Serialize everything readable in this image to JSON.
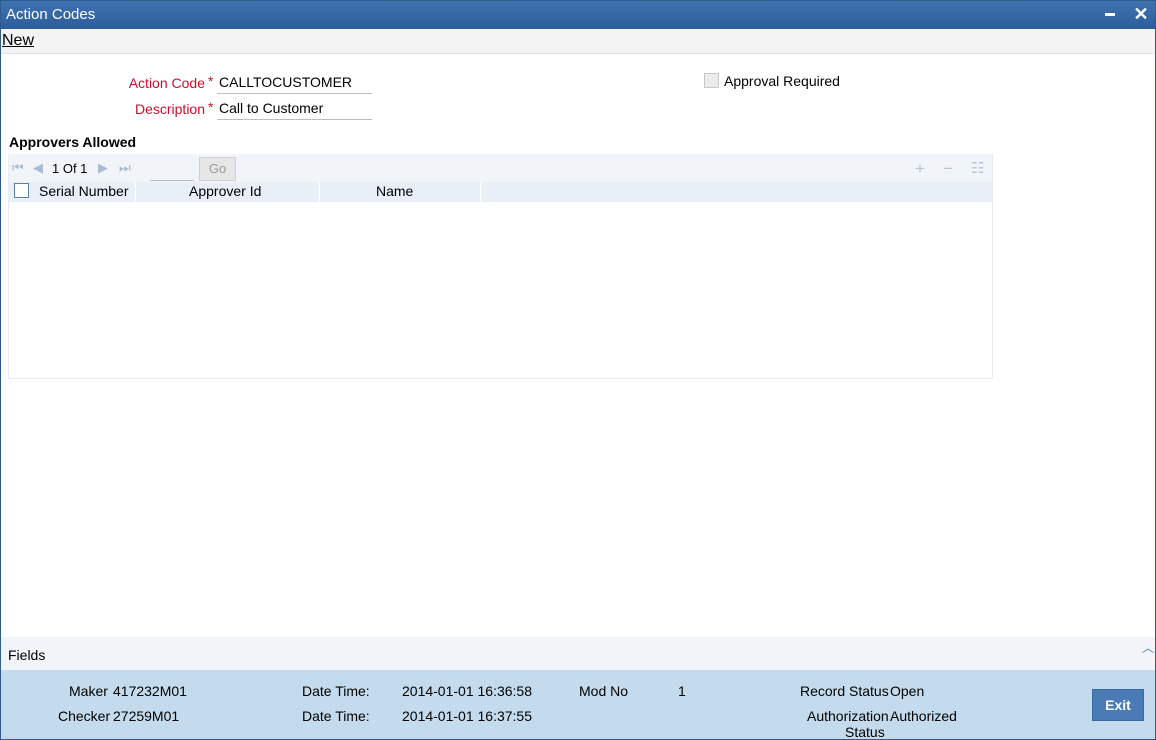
{
  "window": {
    "title": "Action Codes"
  },
  "menu": {
    "new_label": "New"
  },
  "form": {
    "action_code_label": "Action Code",
    "action_code_value": "CALLTOCUSTOMER",
    "description_label": "Description",
    "description_value": "Call to Customer",
    "required_mark": "*",
    "approval_required_label": "Approval Required",
    "approval_required_checked": false
  },
  "approvers": {
    "title": "Approvers Allowed",
    "page_info": "1 Of 1",
    "go_label": "Go",
    "columns": [
      "Serial Number",
      "Approver Id",
      "Name"
    ],
    "rows": []
  },
  "fields_bar": {
    "label": "Fields"
  },
  "footer": {
    "maker_label": "Maker",
    "maker_value": "417232M01",
    "checker_label": "Checker",
    "checker_value": "27259M01",
    "date_time_label": "Date Time:",
    "maker_date_time": "2014-01-01 16:36:58",
    "checker_date_time": "2014-01-01 16:37:55",
    "mod_no_label": "Mod No",
    "mod_no_value": "1",
    "record_status_label": "Record Status",
    "record_status_value": "Open",
    "auth_status_label_1": "Authorization",
    "auth_status_label_2": "Status",
    "auth_status_value": "Authorized",
    "exit_label": "Exit"
  }
}
